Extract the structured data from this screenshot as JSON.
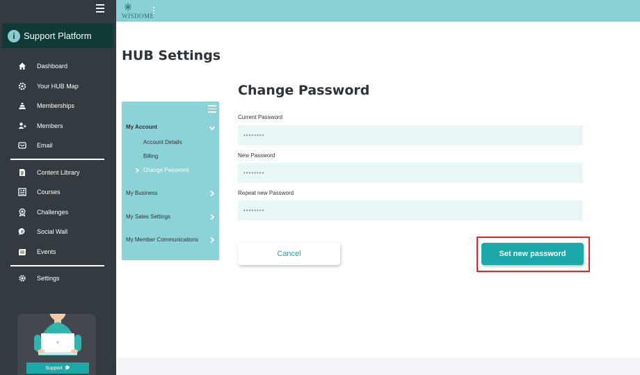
{
  "topbar": {
    "logo_text": "WISDOME",
    "logo_icon": "snowflake-logo-icon",
    "menu_icon": "kebab-menu-icon"
  },
  "sidebar": {
    "toggle_icon": "hamburger-icon",
    "brand": {
      "icon": "info-icon",
      "icon_text": "i",
      "label": "Support Platform"
    },
    "items": [
      {
        "label": "Dashboard",
        "icon": "home-icon"
      },
      {
        "label": "Your HUB Map",
        "icon": "gear-icon"
      },
      {
        "label": "Memberships",
        "icon": "pyramid-icon"
      },
      {
        "label": "Members",
        "icon": "members-icon"
      },
      {
        "label": "Email",
        "icon": "email-icon"
      },
      {
        "label": "Content Library",
        "icon": "document-icon"
      },
      {
        "label": "Courses",
        "icon": "courses-icon"
      },
      {
        "label": "Challenges",
        "icon": "award-icon"
      },
      {
        "label": "Social Wall",
        "icon": "chat-bubble-icon"
      },
      {
        "label": "Events",
        "icon": "calendar-icon"
      },
      {
        "label": "Settings",
        "icon": "settings-icon"
      }
    ],
    "support": {
      "label": "Support",
      "icon": "chat-icon"
    }
  },
  "page": {
    "title": "HUB Settings"
  },
  "settings_menu": {
    "toggle_icon": "hamburger-icon",
    "sections": [
      {
        "label": "My Account",
        "expanded": true,
        "chevron": "chevron-down-icon"
      },
      {
        "label": "My Business",
        "expanded": false,
        "chevron": "chevron-right-icon"
      },
      {
        "label": "My Sales Settings",
        "expanded": false,
        "chevron": "chevron-right-icon"
      },
      {
        "label": "My Member Communications",
        "expanded": false,
        "chevron": "chevron-right-icon"
      }
    ],
    "subitems": [
      {
        "label": "Account Details",
        "active": false
      },
      {
        "label": "Billing",
        "active": false
      },
      {
        "label": "Change Password",
        "active": true
      }
    ]
  },
  "form": {
    "title": "Change Password",
    "fields": [
      {
        "label": "Current Password",
        "value": "••••••••"
      },
      {
        "label": "New Password",
        "value": "••••••••"
      },
      {
        "label": "Repeat new Password",
        "value": "••••••••"
      }
    ],
    "cancel_label": "Cancel",
    "submit_label": "Set new password"
  },
  "colors": {
    "sidebar_bg": "#333a40",
    "brand_bg": "#0f3a35",
    "topbar_bg": "#8bd0d3",
    "menu_bg": "#8bd3d6",
    "accent": "#1aa8a8",
    "field_bg": "#e8f6f5",
    "highlight": "#e0262b"
  }
}
